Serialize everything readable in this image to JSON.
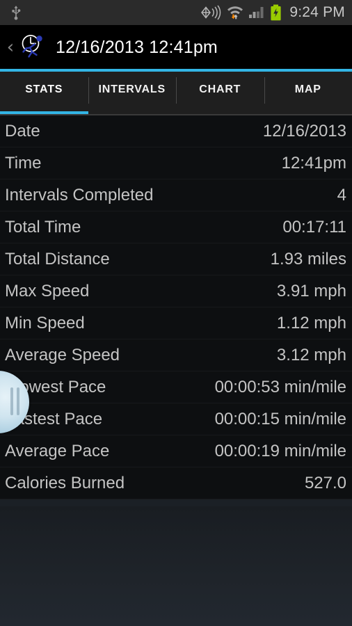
{
  "status_bar": {
    "icons": [
      "usb-icon",
      "gps-icon",
      "wifi-icon",
      "cellular-signal-icon",
      "battery-charging-icon"
    ],
    "clock": "9:24 PM",
    "battery_color": "#99cc00",
    "wifi_arrow_color": "#ff8800"
  },
  "title_bar": {
    "back_label": "‹",
    "app_icon": "clock-runner-icon",
    "title": "12/16/2013 12:41pm"
  },
  "accent_color": "#33b5e5",
  "tabs": [
    {
      "label": "STATS",
      "active": true
    },
    {
      "label": "INTERVALS",
      "active": false
    },
    {
      "label": "CHART",
      "active": false
    },
    {
      "label": "MAP",
      "active": false
    }
  ],
  "stats": [
    {
      "label": "Date",
      "value": "12/16/2013"
    },
    {
      "label": "Time",
      "value": "12:41pm"
    },
    {
      "label": "Intervals Completed",
      "value": "4"
    },
    {
      "label": "Total Time",
      "value": "00:17:11"
    },
    {
      "label": "Total Distance",
      "value": "1.93 miles"
    },
    {
      "label": "Max Speed",
      "value": "3.91 mph"
    },
    {
      "label": "Min Speed",
      "value": "1.12 mph"
    },
    {
      "label": "Average Speed",
      "value": "3.12 mph"
    },
    {
      "label": "Slowest Pace",
      "value": "00:00:53 min/mile"
    },
    {
      "label": "Fastest Pace",
      "value": "00:00:15 min/mile"
    },
    {
      "label": "Average Pace",
      "value": "00:00:19 min/mile"
    },
    {
      "label": "Calories Burned",
      "value": "527.0"
    }
  ],
  "scroll_handle": {
    "name": "fast-scroll-handle"
  }
}
